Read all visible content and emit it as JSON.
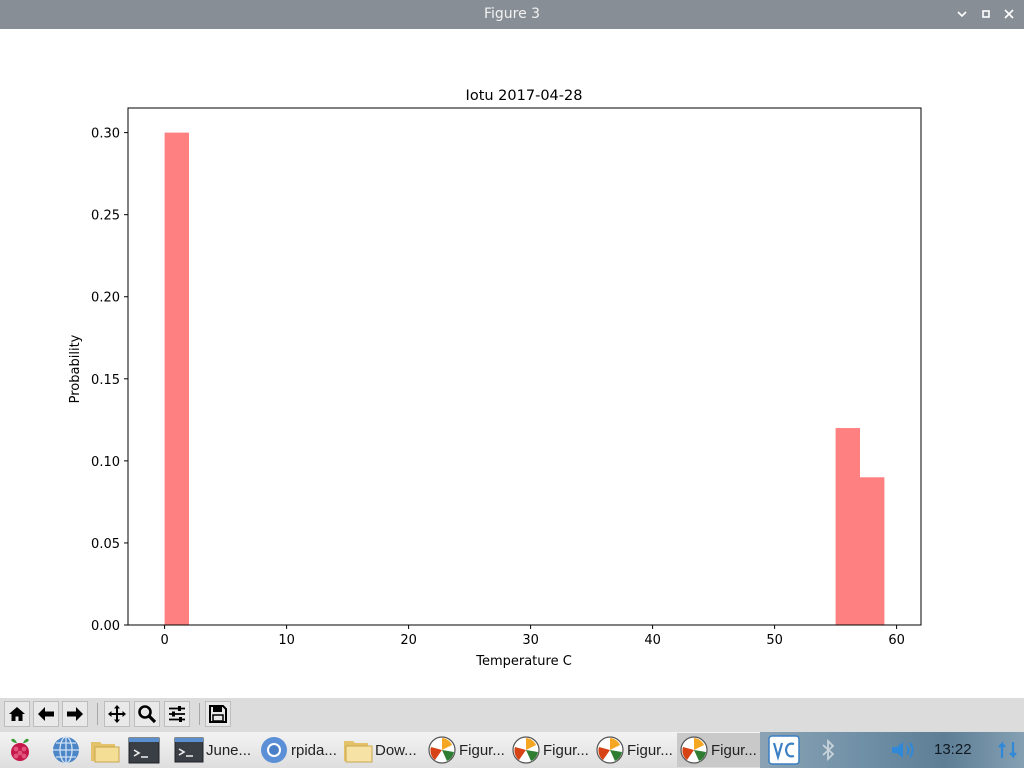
{
  "window": {
    "title": "Figure 3",
    "controls": [
      "chevron-down-icon",
      "maximize-icon",
      "close-icon"
    ]
  },
  "chart_data": {
    "type": "bar",
    "title": "Iotu 2017-04-28",
    "xlabel": "Temperature C",
    "ylabel": "Probability",
    "xlim": [
      -3,
      62
    ],
    "ylim": [
      0.0,
      0.315
    ],
    "xticks": [
      "0",
      "10",
      "20",
      "30",
      "40",
      "50",
      "60"
    ],
    "yticks": [
      "0.00",
      "0.05",
      "0.10",
      "0.15",
      "0.20",
      "0.25",
      "0.30"
    ],
    "bar_width": 2,
    "bars": [
      {
        "x_start": 0,
        "value": 0.3
      },
      {
        "x_start": 55,
        "value": 0.12
      },
      {
        "x_start": 57,
        "value": 0.09
      }
    ],
    "bar_color": "#ff8080",
    "grid": false
  },
  "toolbar": {
    "buttons": [
      {
        "name": "home-button",
        "icon": "home-icon"
      },
      {
        "name": "back-button",
        "icon": "arrow-left-icon"
      },
      {
        "name": "forward-button",
        "icon": "arrow-right-icon"
      },
      {
        "name": "pan-button",
        "icon": "move-icon"
      },
      {
        "name": "zoom-button",
        "icon": "magnifier-icon"
      },
      {
        "name": "configure-subplots-button",
        "icon": "sliders-icon"
      },
      {
        "name": "save-button",
        "icon": "floppy-disk-icon"
      }
    ]
  },
  "taskbar": {
    "launchers": [
      "raspberry-menu-icon",
      "web-browser-icon",
      "file-manager-icon",
      "terminal-icon"
    ],
    "items": [
      {
        "label": "June...",
        "icon": "terminal-icon"
      },
      {
        "label": "rpida...",
        "icon": "chromium-icon"
      },
      {
        "label": "Dow...",
        "icon": "folder-icon"
      },
      {
        "label": "Figur...",
        "icon": "matplotlib-icon"
      },
      {
        "label": "Figur...",
        "icon": "matplotlib-icon"
      },
      {
        "label": "Figur...",
        "icon": "matplotlib-icon"
      },
      {
        "label": "Figur...",
        "icon": "matplotlib-icon"
      }
    ],
    "tray": [
      "vnc-icon",
      "bluetooth-icon",
      "volume-icon",
      "network-icon"
    ],
    "clock": "13:22"
  }
}
